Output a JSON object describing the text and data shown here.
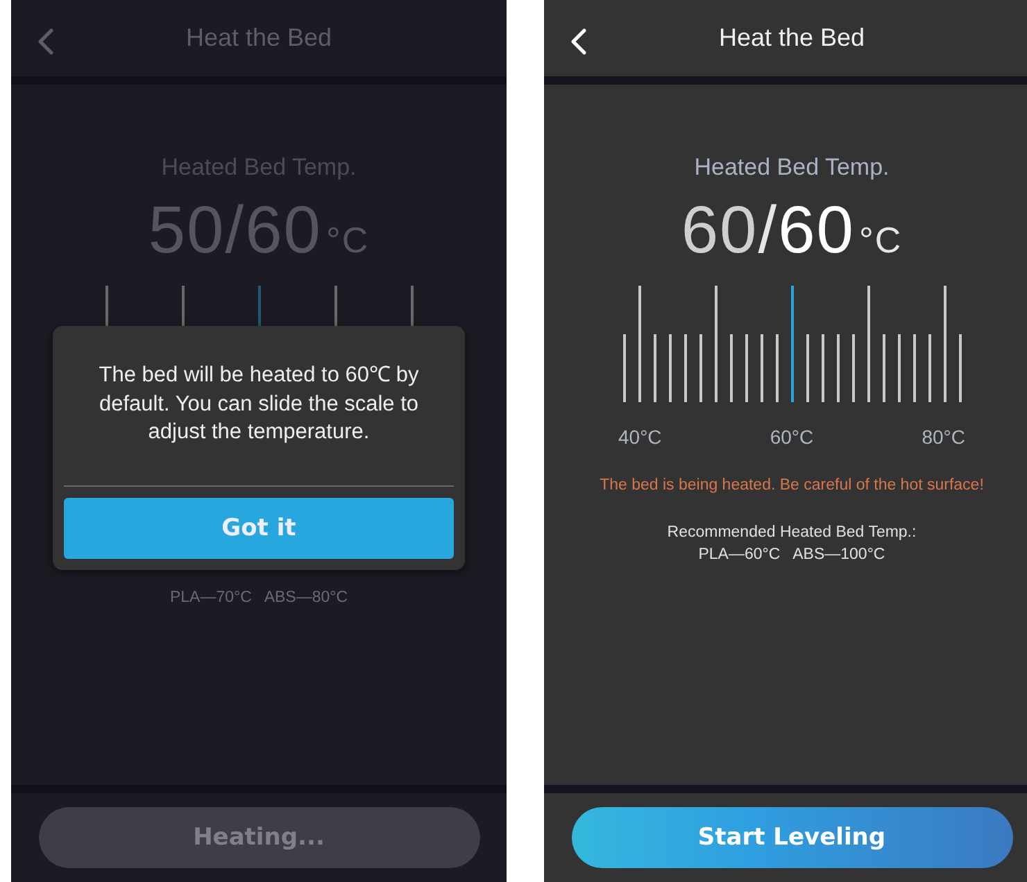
{
  "screens": [
    {
      "title": "Heat the Bed",
      "temp_label": "Heated Bed Temp.",
      "current": "50",
      "separator": "/",
      "target": "60",
      "unit": "°C",
      "recommended": [
        "PLA—70°C   ABS—80°C"
      ],
      "action": {
        "label": "Heating...",
        "disabled": true
      },
      "dialog": {
        "message": "The bed will be heated to 60℃ by default. You can slide the scale to adjust the temperature.",
        "button": "Got it"
      }
    },
    {
      "title": "Heat the Bed",
      "temp_label": "Heated Bed Temp.",
      "current": "60",
      "separator": "/",
      "target": "60",
      "unit": "°C",
      "scale_labels": [
        "40°C",
        "60°C",
        "80°C"
      ],
      "warning": "The bed is being heated. Be careful of the hot surface!",
      "recommended": [
        "Recommended Heated Bed Temp.:",
        "PLA—60°C   ABS—100°C"
      ],
      "action": {
        "label": "Start Leveling",
        "disabled": false
      }
    }
  ]
}
